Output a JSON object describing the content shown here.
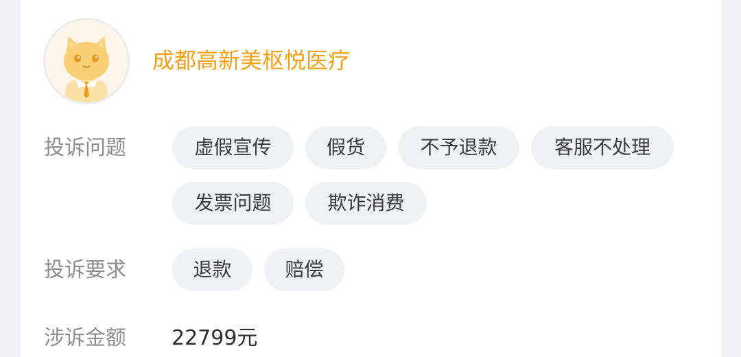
{
  "merchant": {
    "name": "成都高新美枢悦医疗",
    "avatar_icon": "cat-mascot-icon"
  },
  "complaint_issues": {
    "label": "投诉问题",
    "tags": [
      "虚假宣传",
      "假货",
      "不予退款",
      "客服不处理",
      "发票问题",
      "欺诈消费"
    ]
  },
  "complaint_demands": {
    "label": "投诉要求",
    "tags": [
      "退款",
      "赔偿"
    ]
  },
  "amount": {
    "label": "涉诉金额",
    "value": "22799元"
  },
  "colors": {
    "accent": "#f0a119",
    "tag_bg": "#f0f1f3",
    "label_text": "#8d8d8d"
  }
}
